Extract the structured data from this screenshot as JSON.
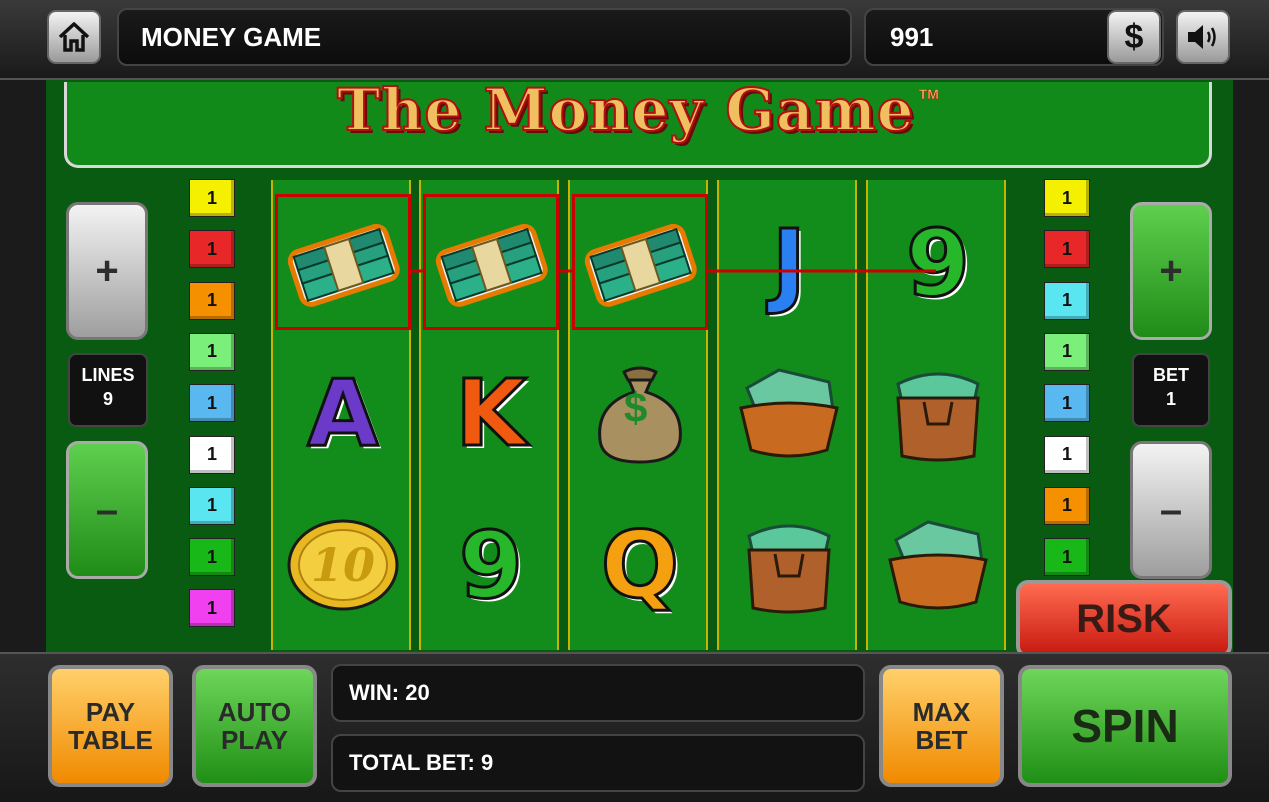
{
  "header": {
    "title": "MONEY GAME",
    "balance": "991",
    "home_icon": "home-icon",
    "dollar_label": "$",
    "sound_icon": "speaker-icon"
  },
  "logo": {
    "text": "The Money Game",
    "tm": "TM"
  },
  "left_controls": {
    "plus": "+",
    "minus": "–",
    "lines_label": "LINES",
    "lines_value": "9"
  },
  "right_controls": {
    "plus": "+",
    "minus": "–",
    "bet_label": "BET",
    "bet_value": "1"
  },
  "left_line_indicators": [
    {
      "value": "1",
      "color": "#f5f000"
    },
    {
      "value": "1",
      "color": "#e82828"
    },
    {
      "value": "1",
      "color": "#f59000"
    },
    {
      "value": "1",
      "color": "#7af07a"
    },
    {
      "value": "1",
      "color": "#5ab8f0"
    },
    {
      "value": "1",
      "color": "#ffffff"
    },
    {
      "value": "1",
      "color": "#5ae6f0"
    },
    {
      "value": "1",
      "color": "#18b818"
    },
    {
      "value": "1",
      "color": "#f040f0"
    }
  ],
  "right_line_indicators": [
    {
      "value": "1",
      "color": "#f5f000"
    },
    {
      "value": "1",
      "color": "#e82828"
    },
    {
      "value": "1",
      "color": "#5ae6f0"
    },
    {
      "value": "1",
      "color": "#7af07a"
    },
    {
      "value": "1",
      "color": "#5ab8f0"
    },
    {
      "value": "1",
      "color": "#ffffff"
    },
    {
      "value": "1",
      "color": "#f59000"
    },
    {
      "value": "1",
      "color": "#18b818"
    }
  ],
  "reels": [
    [
      "cash-stack-icon",
      "A",
      "gold-coin-10-icon"
    ],
    [
      "cash-stack-icon",
      "K",
      "9"
    ],
    [
      "cash-stack-icon",
      "money-bag-icon",
      "Q"
    ],
    [
      "J",
      "wallet-icon",
      "cash-bag-icon"
    ],
    [
      "9",
      "cash-bag-icon",
      "wallet-icon"
    ]
  ],
  "coin_text": "10",
  "bag_symbol": "$",
  "buttons": {
    "pay_table": [
      "PAY",
      "TABLE"
    ],
    "auto_play": [
      "AUTO",
      "PLAY"
    ],
    "max_bet": [
      "MAX",
      "BET"
    ],
    "risk": "RISK",
    "spin": "SPIN"
  },
  "status": {
    "win_label": "WIN:",
    "win_value": "20",
    "total_bet_label": "TOTAL BET:",
    "total_bet_value": "9"
  },
  "colors": {
    "win_line": "#cc0000",
    "felt": "#128c1a"
  }
}
